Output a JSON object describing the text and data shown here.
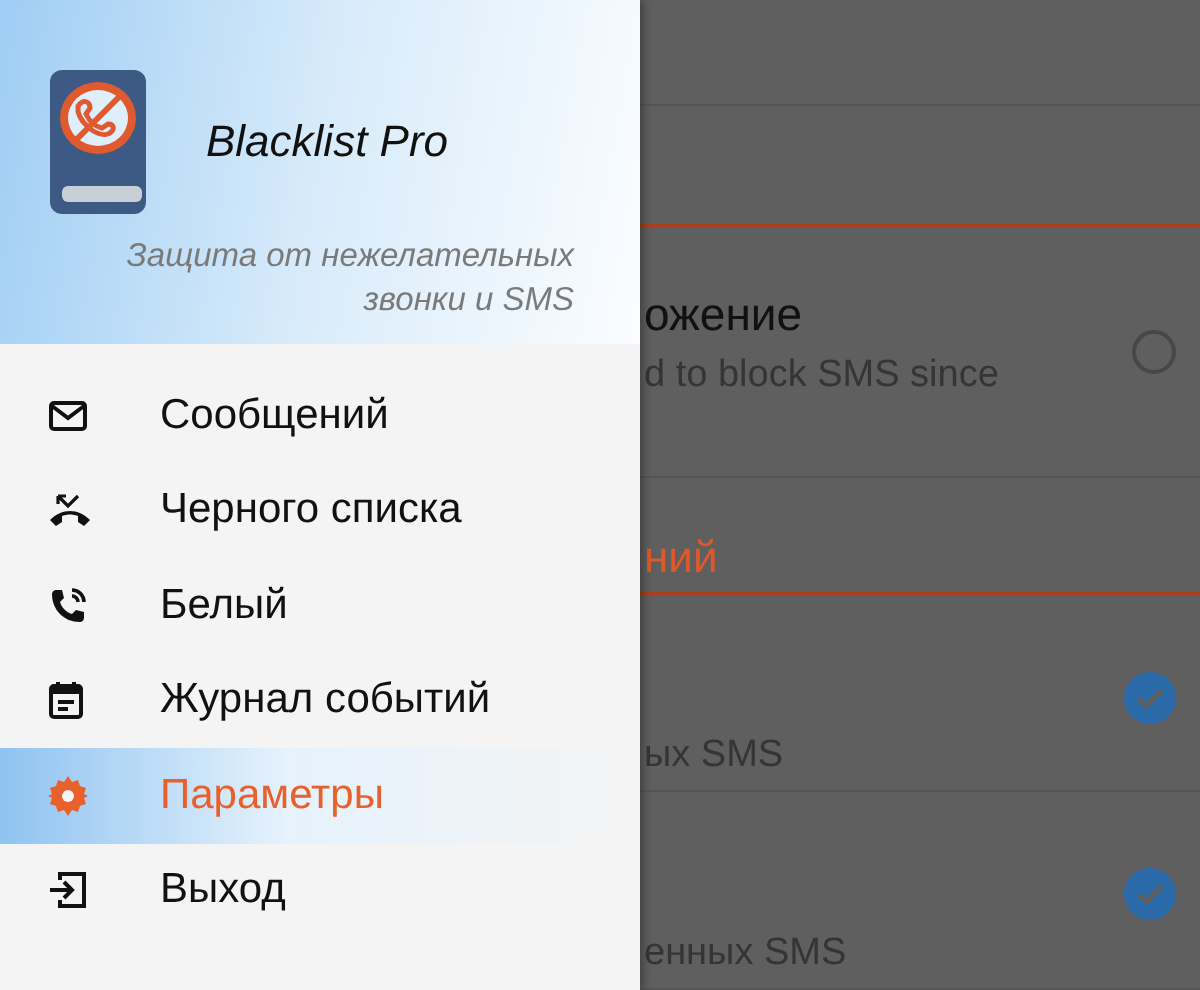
{
  "drawer": {
    "app_name": "Blacklist Pro",
    "tagline": "Защита от нежелательных звонки и SMS",
    "items": [
      {
        "label": "Сообщений",
        "selected": false
      },
      {
        "label": "Черного списка",
        "selected": false
      },
      {
        "label": "Белый",
        "selected": false
      },
      {
        "label": "Журнал событий",
        "selected": false
      },
      {
        "label": "Параметры",
        "selected": true
      },
      {
        "label": "Выход",
        "selected": false
      }
    ]
  },
  "settings": {
    "rows": [
      {
        "kind": "blank"
      },
      {
        "kind": "header"
      },
      {
        "kind": "radio",
        "title": "ожение",
        "subtitle": "d to block SMS since",
        "checked": false
      },
      {
        "kind": "header",
        "title": "ний"
      },
      {
        "kind": "checkbox",
        "subtitle": "ых SMS",
        "checked": true
      },
      {
        "kind": "checkbox",
        "subtitle": "енных SMS",
        "checked": true
      }
    ]
  }
}
